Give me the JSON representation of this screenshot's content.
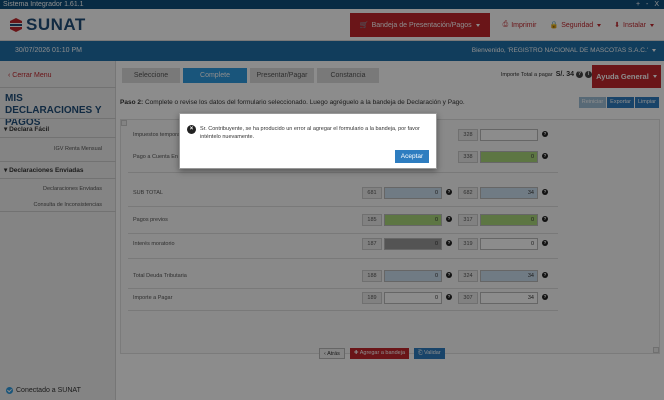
{
  "window": {
    "title": "Sistema Integrador 1.61.1",
    "controls": "+ - X"
  },
  "header": {
    "logo_text": "SUNAT",
    "nav": [
      {
        "label": "Bandeja de Presentación/Pagos"
      },
      {
        "label": "Imprimir"
      },
      {
        "label": "Seguridad"
      },
      {
        "label": "Instalar"
      }
    ]
  },
  "bluebar": {
    "datetime": "30/07/2026 01:10 PM",
    "welcome": "Bienvenido, 'REGISTRO NACIONAL DE MASCOTAS S.A.C.'"
  },
  "sidebar": {
    "back_label": "Cerrar Menu",
    "title": "MIS DECLARACIONES Y PAGOS",
    "sections": [
      {
        "label": "Declara Fácil",
        "links": [
          "IGV Renta Mensual"
        ]
      },
      {
        "label": "Declaraciones Enviadas",
        "links": [
          "Declaraciones Enviadas",
          "Consulta de Inconsistencias"
        ]
      }
    ],
    "status": "Conectado a SUNAT"
  },
  "wizard": {
    "steps": [
      "Seleccione",
      "Complete",
      "Presentar/Pagar",
      "Constancia"
    ],
    "active": 1
  },
  "total": {
    "label": "Importe Total a pagar",
    "value": "S/. 34"
  },
  "help_label": "Ayuda General",
  "instructions": {
    "step": "Paso 2:",
    "text": "Complete o revise los datos del formulario seleccionado. Luego agréguelo a la bandeja de Declaración y Pago."
  },
  "toolbar": {
    "buttons": [
      "Reiniciar",
      "Exportar",
      "Limpiar"
    ]
  },
  "form": {
    "rows": [
      {
        "label": "Impuestos temporal",
        "code1": "",
        "val1": "",
        "code2": "328",
        "val2": ""
      },
      {
        "label": "Pago a Cuenta En I",
        "code1": "",
        "val1": "",
        "code2": "338",
        "val2": "0"
      },
      {
        "label": "SUB TOTAL",
        "code1": "681",
        "val1": "0",
        "code2": "682",
        "val2": "34"
      },
      {
        "label": "Pagos previos",
        "code1": "185",
        "val1": "0",
        "code2": "317",
        "val2": "0"
      },
      {
        "label": "Interés moratorio",
        "code1": "187",
        "val1": "0",
        "code2": "319",
        "val2": "0"
      },
      {
        "label": "Total Deuda Tributaria",
        "code1": "188",
        "val1": "0",
        "code2": "324",
        "val2": "34"
      },
      {
        "label": "Importe a Pagar",
        "code1": "189",
        "val1": "0",
        "code2": "307",
        "val2": "34"
      }
    ]
  },
  "bottom_buttons": {
    "back": "Atrás",
    "add": "Agregar a bandeja",
    "validate": "Validar"
  },
  "dialog": {
    "message": "Sr. Contribuyente, se ha producido un error al agregar el formulario a la bandeja, por favor inténtelo nuevamente.",
    "ok_label": "Aceptar"
  },
  "colors": {
    "brand_red": "#c1272d",
    "brand_blue": "#1f6fa8",
    "accent_blue": "#2e9be0",
    "field_blue": "#cde0f0",
    "field_green": "#a9d77a"
  }
}
